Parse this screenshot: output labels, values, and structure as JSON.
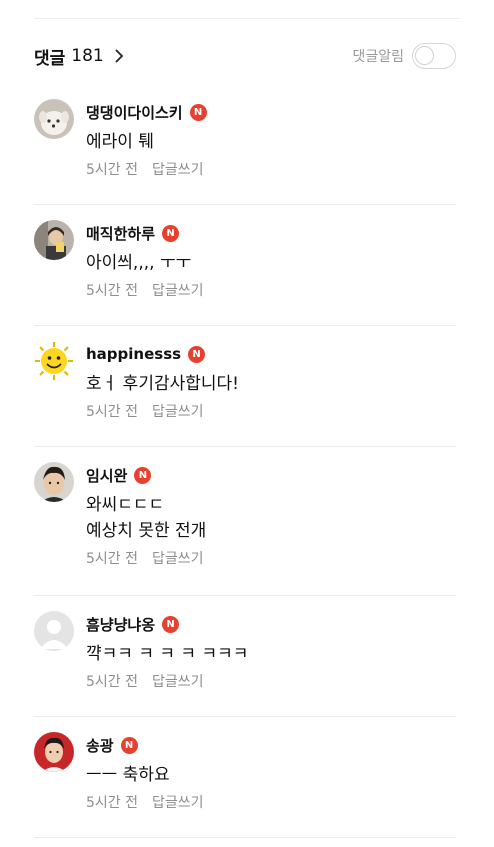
{
  "header": {
    "comments_label": "댓글",
    "comment_count": "181",
    "notify_label": "댓글알림",
    "notify_on": false
  },
  "colors": {
    "badge": "#e8402f",
    "meta_text": "#8e8e8e"
  },
  "comments": [
    {
      "username": "댕댕이다이스키",
      "badge": "N",
      "text": "에라이 퉤",
      "time": "5시간 전",
      "reply_label": "답글쓰기",
      "avatar": "puppy"
    },
    {
      "username": "매직한하루",
      "badge": "N",
      "text": "아이씌,,,, ㅜㅜ",
      "time": "5시간 전",
      "reply_label": "답글쓰기",
      "avatar": "photo"
    },
    {
      "username": "happinesss",
      "badge": "N",
      "text": "호ㅓ 후기감사합니다!",
      "time": "5시간 전",
      "reply_label": "답글쓰기",
      "avatar": "smiley"
    },
    {
      "username": "임시완",
      "badge": "N",
      "text": "와씨ㄷㄷㄷ\n예상치 못한 전개",
      "time": "5시간 전",
      "reply_label": "답글쓰기",
      "avatar": "person"
    },
    {
      "username": "흠냥냥냐옹",
      "badge": "N",
      "text": "꺅ㅋㅋ ㅋ ㅋ ㅋ ㅋㅋㅋ",
      "time": "5시간 전",
      "reply_label": "답글쓰기",
      "avatar": "default"
    },
    {
      "username": "송광",
      "badge": "N",
      "text": "ㅡㅡ 축하요",
      "time": "5시간 전",
      "reply_label": "답글쓰기",
      "avatar": "person-red"
    }
  ]
}
